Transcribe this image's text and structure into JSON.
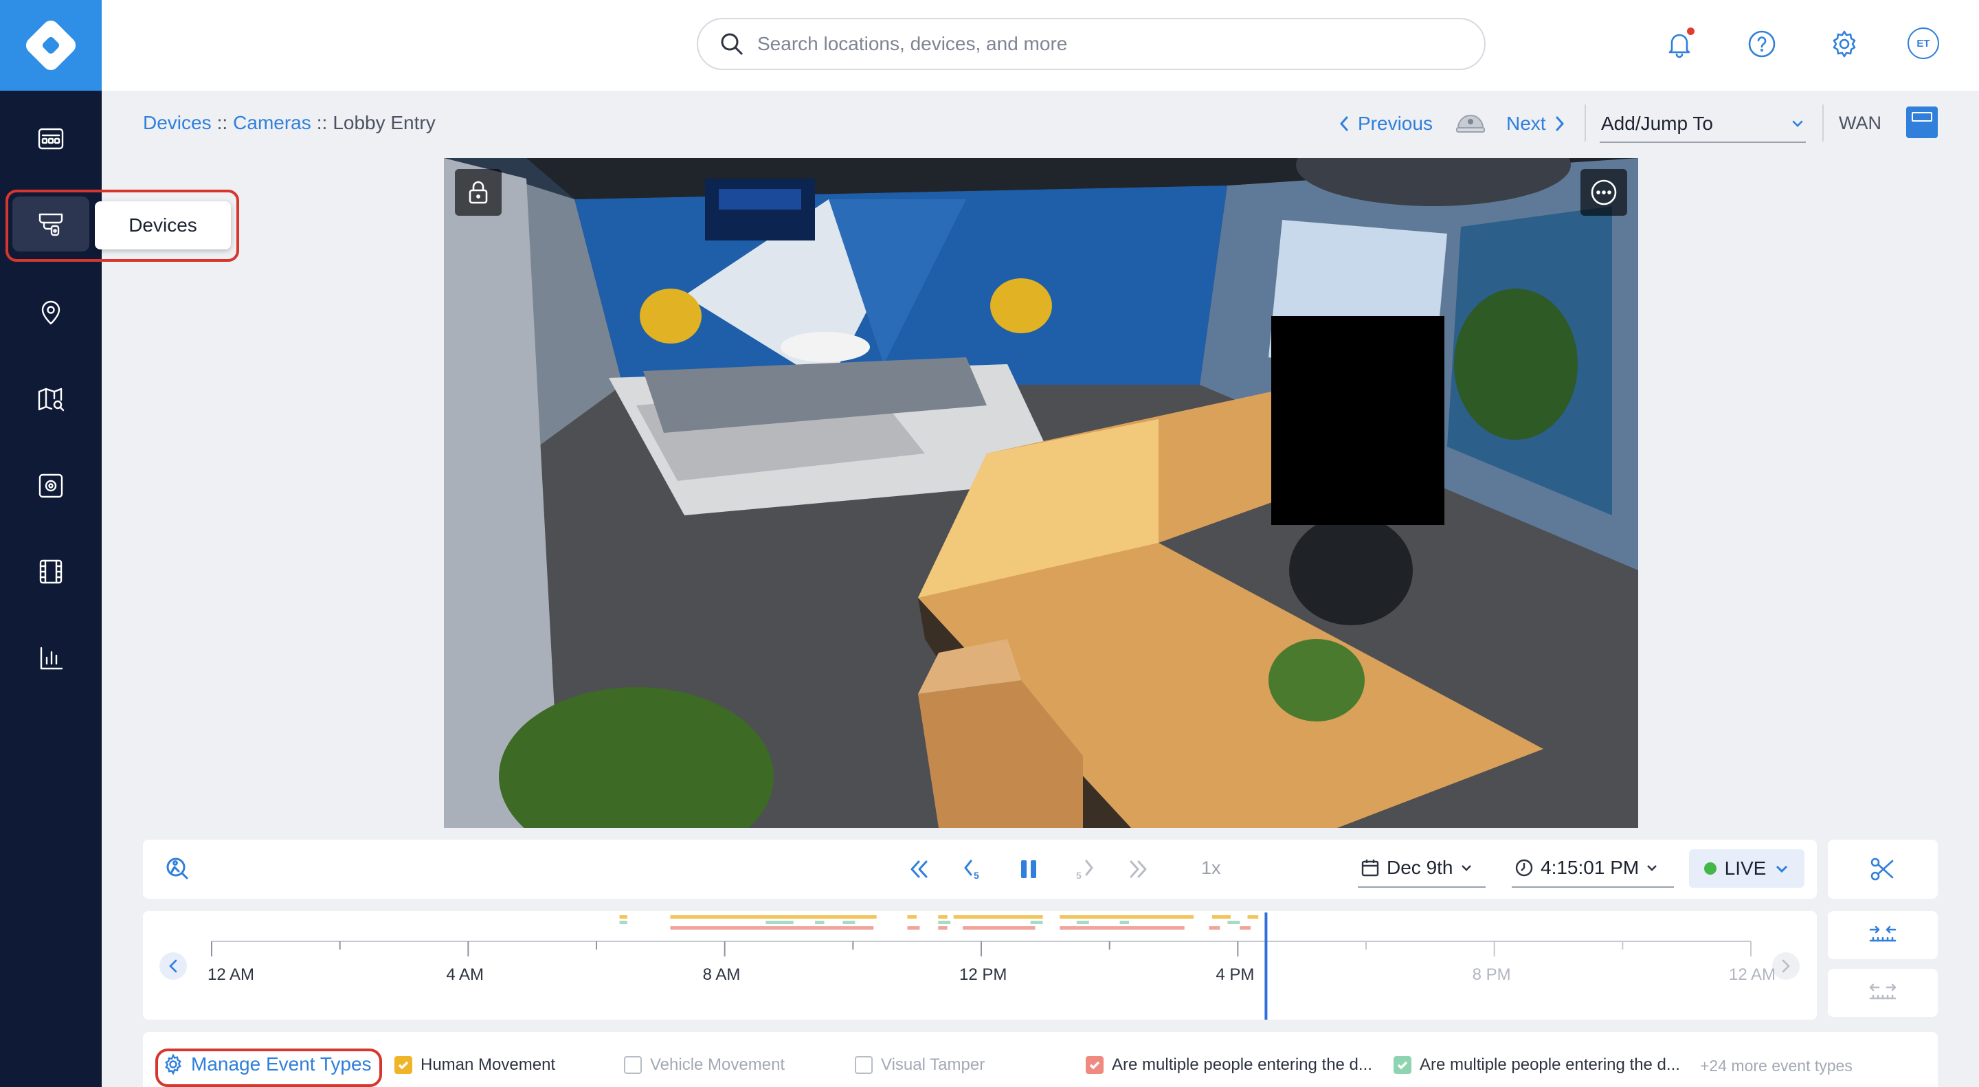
{
  "sidebar": {
    "tooltip": "Devices",
    "items": [
      {
        "name": "dashboard-icon"
      },
      {
        "name": "devices-icon"
      },
      {
        "name": "location-pin-icon"
      },
      {
        "name": "map-search-icon"
      },
      {
        "name": "integrations-icon"
      },
      {
        "name": "film-icon"
      },
      {
        "name": "bar-chart-icon"
      }
    ]
  },
  "header": {
    "search_placeholder": "Search locations, devices, and more",
    "avatar_initials": "ET"
  },
  "breadcrumb": {
    "devices": "Devices",
    "sep1": "::",
    "cameras": "Cameras",
    "sep2": "::",
    "current": "Lobby Entry"
  },
  "nav": {
    "previous": "Previous",
    "next": "Next",
    "add_jump": "Add/Jump To",
    "network": "WAN"
  },
  "player": {
    "speed": "1x",
    "date": "Dec 9th",
    "time": "4:15:01 PM",
    "live": "LIVE"
  },
  "timeline": {
    "labels": [
      "12 AM",
      "4 AM",
      "8 AM",
      "12 PM",
      "4 PM",
      "8 PM",
      "12 AM"
    ],
    "current_position_fraction": 0.685
  },
  "events": {
    "manage": "Manage Event Types",
    "types": [
      {
        "label": "Human Movement",
        "checked": true,
        "color": "#f0b429"
      },
      {
        "label": "Vehicle Movement",
        "checked": false,
        "color": "#b7bcc6"
      },
      {
        "label": "Visual Tamper",
        "checked": false,
        "color": "#b7bcc6"
      },
      {
        "label": "Are multiple people entering the d...",
        "checked": true,
        "color": "#ef8a80"
      },
      {
        "label": "Are multiple people entering the d...",
        "checked": true,
        "color": "#8fd4b0"
      }
    ],
    "more": "+24 more event types"
  },
  "colors": {
    "accent": "#2f7fdb",
    "sidebar": "#0f1a36",
    "live": "#44b749",
    "highlight_ring": "#d6362c"
  }
}
